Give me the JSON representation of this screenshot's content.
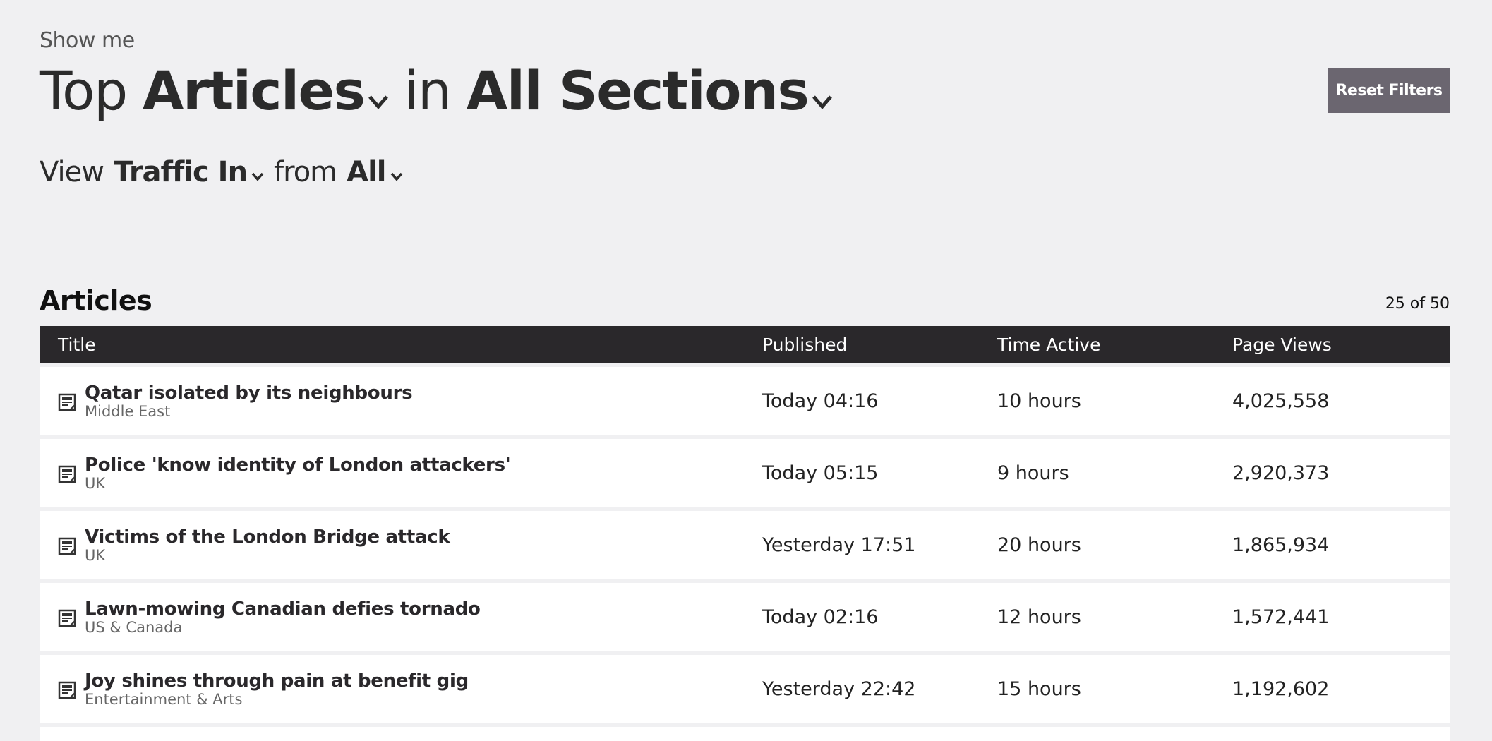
{
  "header": {
    "show_me": "Show me",
    "top_word": "Top",
    "type_selector": "Articles",
    "in_word": "in",
    "section_selector": "All Sections",
    "view_word": "View",
    "view_selector": "Traffic In",
    "from_word": "from",
    "from_selector": "All",
    "reset_button": "Reset Filters"
  },
  "articles": {
    "heading": "Articles",
    "count": "25 of 50",
    "columns": {
      "title": "Title",
      "published": "Published",
      "time_active": "Time Active",
      "page_views": "Page Views"
    },
    "rows": [
      {
        "title": "Qatar isolated by its neighbours",
        "section": "Middle East",
        "published": "Today 04:16",
        "time_active": "10 hours",
        "page_views": "4,025,558"
      },
      {
        "title": "Police 'know identity of London attackers'",
        "section": "UK",
        "published": "Today 05:15",
        "time_active": "9 hours",
        "page_views": "2,920,373"
      },
      {
        "title": "Victims of the London Bridge attack",
        "section": "UK",
        "published": "Yesterday 17:51",
        "time_active": "20 hours",
        "page_views": "1,865,934"
      },
      {
        "title": "Lawn-mowing Canadian defies tornado",
        "section": "US & Canada",
        "published": "Today 02:16",
        "time_active": "12 hours",
        "page_views": "1,572,441"
      },
      {
        "title": "Joy shines through pain at benefit gig",
        "section": "Entertainment & Arts",
        "published": "Yesterday 22:42",
        "time_active": "15 hours",
        "page_views": "1,192,602"
      }
    ]
  },
  "icons": {
    "dropdown": "chevron-down-icon",
    "article": "article-icon"
  }
}
